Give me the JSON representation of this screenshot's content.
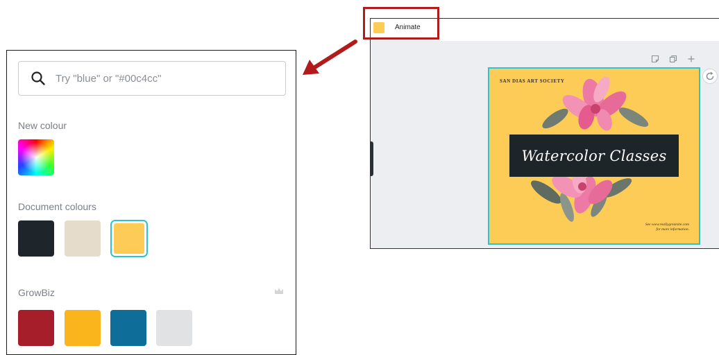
{
  "color_panel": {
    "search": {
      "placeholder": "Try \"blue\" or \"#00c4cc\"",
      "value": "",
      "icon": "search-icon"
    },
    "new_colour": {
      "title": "New colour",
      "icon": "color-picker-icon"
    },
    "document_colours": {
      "title": "Document colours",
      "swatches": [
        "#1f262b",
        "#e6dccc",
        "#fdcc57"
      ],
      "selected": "#fdcc57"
    },
    "brand_kit": {
      "title": "GrowBiz",
      "icon": "crown-icon",
      "swatches": [
        "#a61e2a",
        "#f9b51b",
        "#0f6e99",
        "#e1e2e3"
      ]
    }
  },
  "editor": {
    "toolbar": {
      "animate_label": "Animate",
      "animate_swatch": "#fdcc57"
    },
    "canvas_tools": [
      "note-icon",
      "duplicate-icon",
      "add-page-icon",
      "refresh-icon"
    ],
    "design": {
      "brand": "SAN DIAS ART SOCIETY",
      "headline": "Watercolor Classes",
      "footer_line1": "See www.reallygreatsite.com",
      "footer_line2": "for more information.",
      "background": "#fdcc57",
      "banner_color": "#1e2529"
    }
  },
  "annotation": {
    "highlight_color": "#b11b1b",
    "arrow_color": "#b11b1b"
  }
}
